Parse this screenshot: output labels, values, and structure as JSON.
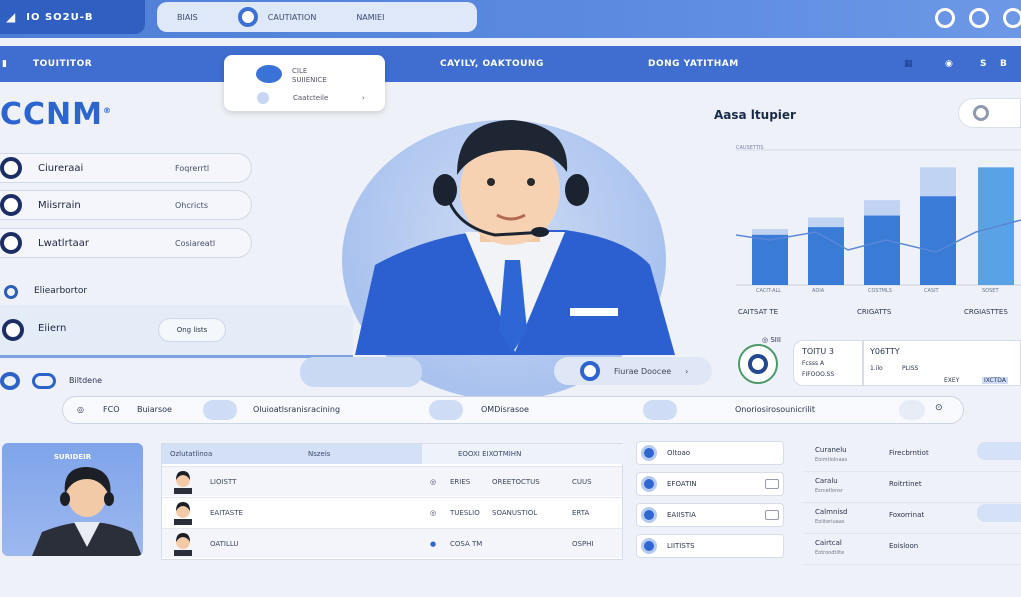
{
  "topbar": {
    "brand": "IO SO2U-B",
    "search_left": "BIAIS",
    "search_mid": "CAUTIATION",
    "search_right": "NAMIEI"
  },
  "navbar": {
    "items": [
      "TOUITITOR",
      "CAYILY, OAKTOUNG",
      "DONG YATITHAM"
    ],
    "right_labels": [
      "S",
      "B"
    ]
  },
  "popup": {
    "line1": "CILE",
    "line2": "SUIIENICE",
    "line3": "Caatcteile"
  },
  "logo": {
    "text": "CCNM",
    "mark": "®"
  },
  "left_menu": [
    {
      "label": "Ciureraai",
      "value": "Foqrerrtl"
    },
    {
      "label": "Miisrrain",
      "value": "Ohcricts"
    },
    {
      "label": "Lwatlrtaar",
      "value": "Cosiareatl"
    }
  ],
  "section_label": "Eliearbortor",
  "selected_item": {
    "label": "Eiiern",
    "value": "Ong lists"
  },
  "sub_label": "Biltdene",
  "chart_title": "Aasa ltupier",
  "chart_data": {
    "type": "bar",
    "categories": [
      "CACIT-ALL",
      "ADIA",
      "COSTMLS",
      "CASIT",
      "SOSET"
    ],
    "series": [
      {
        "values": [
          52,
          60,
          72,
          92
        ]
      },
      {
        "values": [
          58,
          70,
          88,
          122
        ]
      }
    ],
    "legend": "CAUSETTIS"
  },
  "chart_footer": [
    "CAITSAT TE",
    "CRIGATTS",
    "CRGIASTTES"
  ],
  "mid_button": "Fiurae Doocee",
  "agent_card": {
    "title": "TOITU 3",
    "sub1": "Fcsss A",
    "sub2": "FIFOOO.SS",
    "right_title": "Y06TTY",
    "right_sub1": "1.ilo",
    "right_sub2": "PLISS",
    "tag1": "EXEY",
    "tag2": "IXCTDA"
  },
  "search_strip": {
    "item1": "FCO",
    "item2": "Buiarsoe",
    "item3": "Oluioatlsranisracining",
    "item4": "OMDisrasoe",
    "item5": "Onoriosirosounicrilit"
  },
  "person_card": {
    "title": "SURIDEIR"
  },
  "table": {
    "headers": [
      "Ozlutatlinoa",
      "Nszeis",
      "EOOXI EIXOTMIHN"
    ],
    "rows": [
      {
        "name": "LIOISTT",
        "c2": "ERIES",
        "c3": "OREETOCTUS",
        "c4": "CUUS"
      },
      {
        "name": "EAITASTE",
        "c2": "TUESLIO",
        "c3": "SOANUSTIOL",
        "c4": "ERTA"
      },
      {
        "name": "OATILLU",
        "c2": "COSA TM",
        "c3": "",
        "c4": "OSPHI"
      }
    ]
  },
  "right_list": [
    {
      "label": "Oltoao"
    },
    {
      "label": "EFOATIN"
    },
    {
      "label": "EAIISTIA"
    },
    {
      "label": "LIITISTS"
    }
  ],
  "far_right": [
    {
      "c1": "Curanelu",
      "c1s": "Eoimtiolnaas",
      "c2": "Firecbrntiot"
    },
    {
      "c1": "Caralu",
      "c1s": "Esrcetlonsr",
      "c2": "Roitrtinet"
    },
    {
      "c1": "Calmnisd",
      "c1s": "Eoiiteriuaas",
      "c2": "Foxorrinat"
    },
    {
      "c1": "Cairtcal",
      "c1s": "Eotroodtilte",
      "c2": "Eoisloon"
    }
  ]
}
